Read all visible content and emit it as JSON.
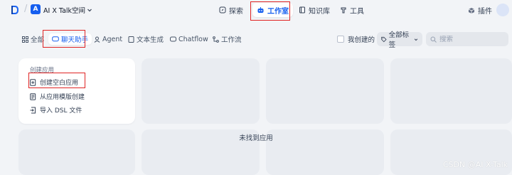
{
  "header": {
    "workspace_initial": "A",
    "workspace_name": "AI X Talk空间",
    "nav": [
      {
        "label": "探索"
      },
      {
        "label": "工作室"
      },
      {
        "label": "知识库"
      },
      {
        "label": "工具"
      }
    ],
    "plugin_label": "插件"
  },
  "filters": {
    "tabs": [
      {
        "label": "全部"
      },
      {
        "label": "聊天助手"
      },
      {
        "label": "Agent"
      },
      {
        "label": "文本生成"
      },
      {
        "label": "Chatflow"
      },
      {
        "label": "工作流"
      }
    ],
    "mine_label": "我创建的",
    "tags_label": "全部标签",
    "search_placeholder": "搜索"
  },
  "create_card": {
    "title": "创建应用",
    "items": [
      {
        "label": "创建空白应用"
      },
      {
        "label": "从应用模版创建"
      },
      {
        "label": "导入 DSL 文件"
      }
    ]
  },
  "empty_text": "未找到应用",
  "watermark": "CSDN @AI X-Talk",
  "colors": {
    "accent": "#155eef",
    "highlight_box": "#e02424"
  }
}
